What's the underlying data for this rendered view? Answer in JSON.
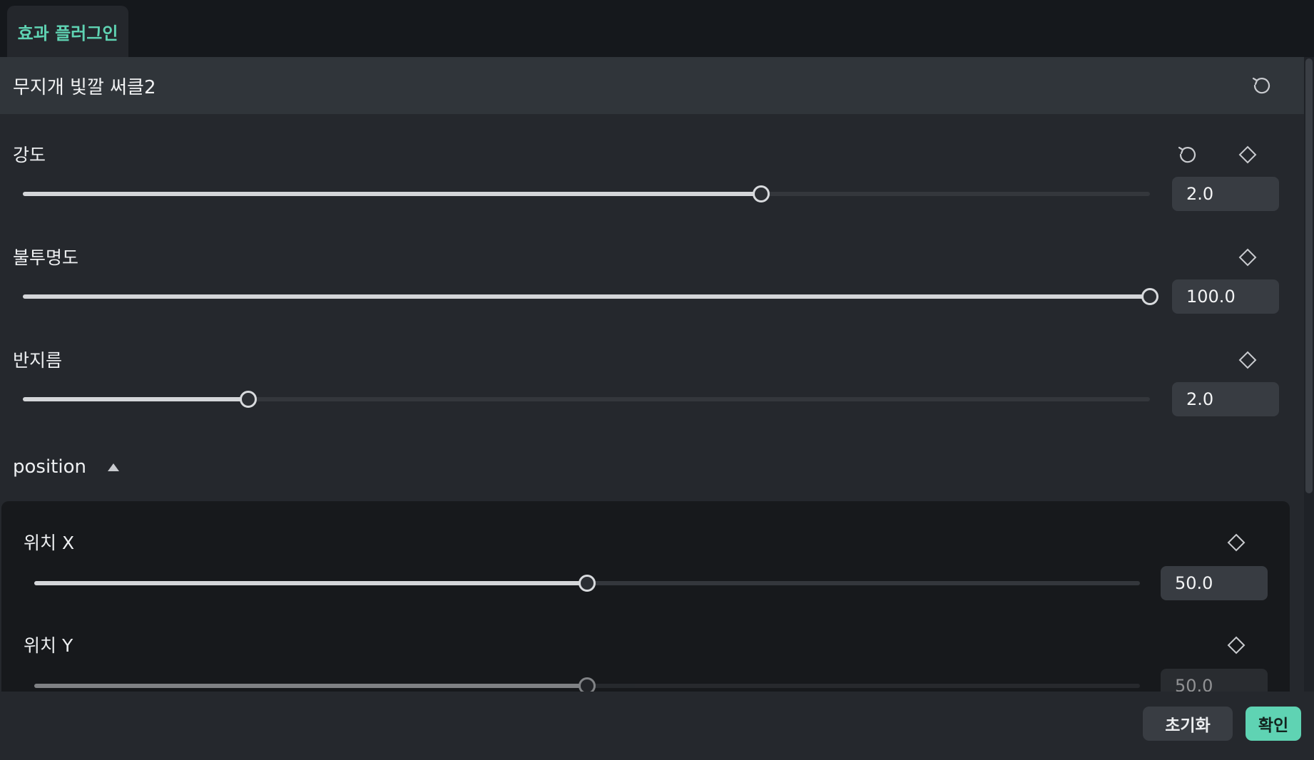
{
  "tab": {
    "label": "효과 플러그인"
  },
  "effect": {
    "title": "무지개 빛깔 써클2"
  },
  "params": [
    {
      "label": "강도",
      "value": "2.0",
      "fraction": 0.655
    },
    {
      "label": "불투명도",
      "value": "100.0",
      "fraction": 1.0
    },
    {
      "label": "반지름",
      "value": "2.0",
      "fraction": 0.2
    }
  ],
  "position_group": {
    "label": "position",
    "params": [
      {
        "label": "위치 X",
        "value": "50.0",
        "fraction": 0.5
      },
      {
        "label": "위치 Y",
        "value": "50.0",
        "fraction": 0.5
      }
    ]
  },
  "buttons": {
    "reset": "초기화",
    "confirm": "확인"
  },
  "icons": {
    "reset": "reset-icon",
    "keyframe": "keyframe-diamond-icon",
    "collapse": "caret-up-icon"
  },
  "colors": {
    "accent": "#5fd3b3",
    "panel": "#25282d",
    "header": "#30353a",
    "group": "#17191c"
  }
}
